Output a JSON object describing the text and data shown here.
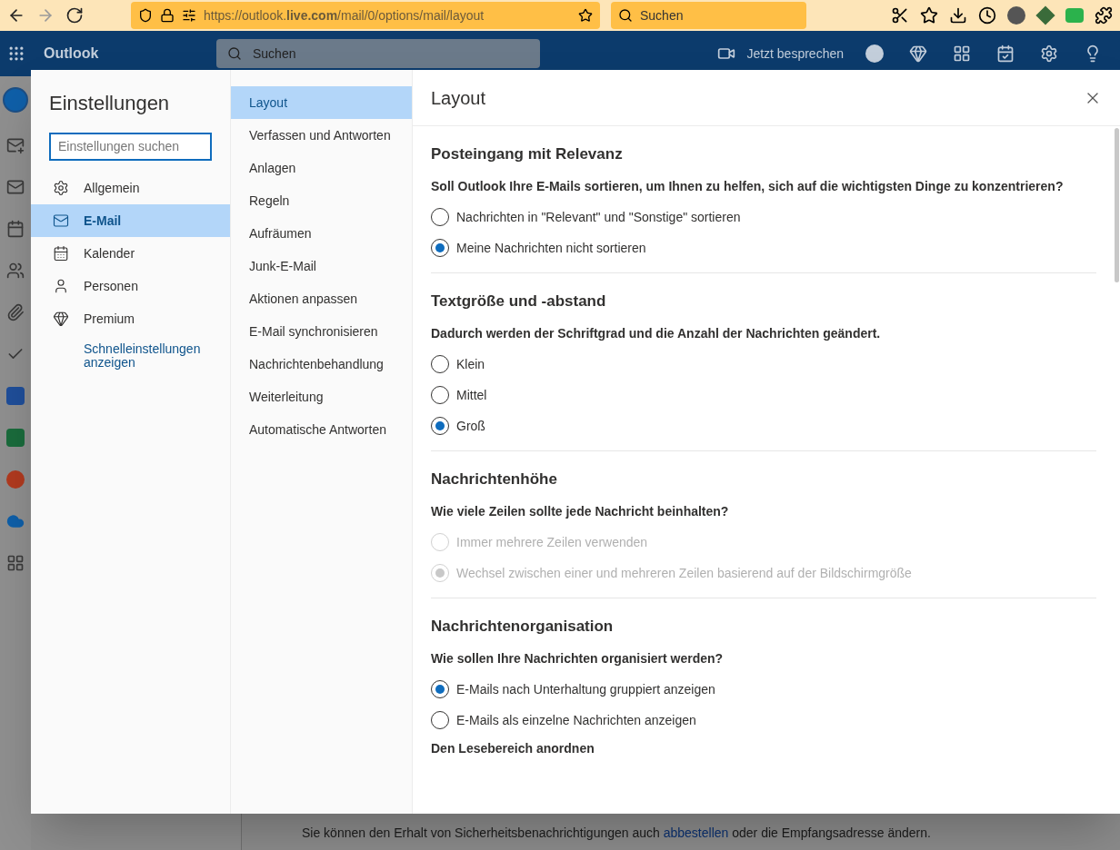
{
  "browser": {
    "url": "https://outlook.**live.com**/mail/0/options/mail/layout",
    "search_placeholder": "Suchen"
  },
  "header": {
    "brand": "Outlook",
    "search_placeholder": "Suchen",
    "meet": "Jetzt besprechen"
  },
  "background_notice": {
    "before": "Sie können den Erhalt von Sicherheitsbenachrichtigungen auch ",
    "link": "abbestellen",
    "after": " oder die Empfangsadresse ändern."
  },
  "settings": {
    "title": "Einstellungen",
    "search_placeholder": "Einstellungen suchen",
    "categories": [
      {
        "label": "Allgemein",
        "selected": false
      },
      {
        "label": "E-Mail",
        "selected": true
      },
      {
        "label": "Kalender",
        "selected": false
      },
      {
        "label": "Personen",
        "selected": false
      },
      {
        "label": "Premium",
        "selected": false
      }
    ],
    "quick_link": "Schnelleinstellungen anzeigen",
    "subnav": [
      {
        "label": "Layout",
        "selected": true
      },
      {
        "label": "Verfassen und Antworten",
        "selected": false
      },
      {
        "label": "Anlagen",
        "selected": false
      },
      {
        "label": "Regeln",
        "selected": false
      },
      {
        "label": "Aufräumen",
        "selected": false
      },
      {
        "label": "Junk-E-Mail",
        "selected": false
      },
      {
        "label": "Aktionen anpassen",
        "selected": false
      },
      {
        "label": "E-Mail synchronisieren",
        "selected": false
      },
      {
        "label": "Nachrichtenbehandlung",
        "selected": false
      },
      {
        "label": "Weiterleitung",
        "selected": false
      },
      {
        "label": "Automatische Antworten",
        "selected": false
      }
    ],
    "panel_title": "Layout",
    "sections": [
      {
        "title": "Posteingang mit Relevanz",
        "question": "Soll Outlook Ihre E-Mails sortieren, um Ihnen zu helfen, sich auf die wichtigsten Dinge zu konzentrieren?",
        "options": [
          {
            "label": "Nachrichten in \"Relevant\" und \"Sonstige\" sortieren",
            "selected": false,
            "disabled": false
          },
          {
            "label": "Meine Nachrichten nicht sortieren",
            "selected": true,
            "disabled": false
          }
        ]
      },
      {
        "title": "Textgröße und -abstand",
        "question": "Dadurch werden der Schriftgrad und die Anzahl der Nachrichten geändert.",
        "options": [
          {
            "label": "Klein",
            "selected": false,
            "disabled": false
          },
          {
            "label": "Mittel",
            "selected": false,
            "disabled": false
          },
          {
            "label": "Groß",
            "selected": true,
            "disabled": false
          }
        ]
      },
      {
        "title": "Nachrichtenhöhe",
        "question": "Wie viele Zeilen sollte jede Nachricht beinhalten?",
        "options": [
          {
            "label": "Immer mehrere Zeilen verwenden",
            "selected": false,
            "disabled": true
          },
          {
            "label": "Wechsel zwischen einer und mehreren Zeilen basierend auf der Bildschirmgröße",
            "selected": true,
            "disabled": true
          }
        ]
      },
      {
        "title": "Nachrichtenorganisation",
        "question": "Wie sollen Ihre Nachrichten organisiert werden?",
        "options": [
          {
            "label": "E-Mails nach Unterhaltung gruppiert anzeigen",
            "selected": true,
            "disabled": false
          },
          {
            "label": "E-Mails als einzelne Nachrichten anzeigen",
            "selected": false,
            "disabled": false
          }
        ],
        "subheading": "Den Lesebereich anordnen"
      }
    ]
  }
}
